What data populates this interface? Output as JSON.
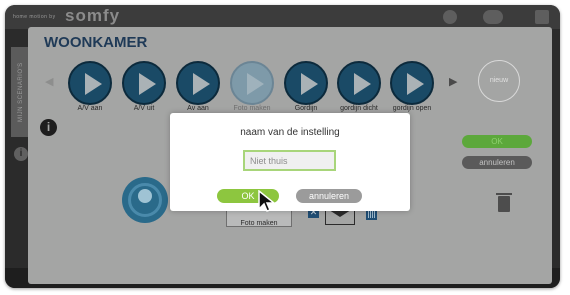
{
  "app": {
    "tagline": "home motion by",
    "brand": "somfy"
  },
  "sidebar": {
    "tab_label": "MIJN SCENARIO'S"
  },
  "panel": {
    "title": "WOONKAMER",
    "scenes": [
      {
        "label": "A/V aan",
        "enabled": true
      },
      {
        "label": "A/V uit",
        "enabled": true
      },
      {
        "label": "Av aan",
        "enabled": true
      },
      {
        "label": "Foto maken",
        "enabled": false
      },
      {
        "label": "Gordijn",
        "enabled": true
      },
      {
        "label": "gordijn dicht",
        "enabled": true
      },
      {
        "label": "gordijn open",
        "enabled": true
      }
    ],
    "new_label": "nieuw",
    "ok_label": "OK",
    "cancel_label": "annuleren",
    "photo_label": "Foto maken"
  },
  "dialog": {
    "title": "naam van de instelling",
    "input_value": "Niet thuis",
    "ok_label": "OK",
    "cancel_label": "annuleren"
  },
  "icons": {
    "info": "info-icon",
    "play": "play-icon",
    "close": "close-icon",
    "mail": "mail-icon",
    "calendar": "calendar-icon",
    "trash": "trash-icon",
    "cursor": "mouse-pointer-icon"
  },
  "colors": {
    "accent_green": "#8dc63f",
    "scene_button": "#1a4a66",
    "title_blue": "#1f3a57",
    "overlay_gray": "#a4a5a4"
  }
}
